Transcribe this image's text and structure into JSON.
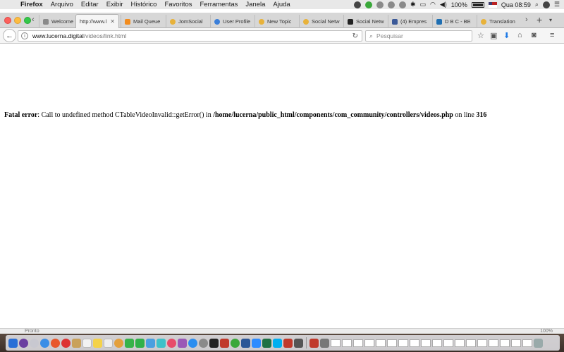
{
  "menubar": {
    "apple_icon": "apple-logo-icon",
    "items": [
      "Firefox",
      "Arquivo",
      "Editar",
      "Exibir",
      "Histórico",
      "Favoritos",
      "Ferramentas",
      "Janela",
      "Ajuda"
    ],
    "battery": "100%",
    "clock": "Qua 08:59"
  },
  "tabs": [
    {
      "label": "Welcome t",
      "icon": "joomla-icon",
      "active": false
    },
    {
      "label": "http://www.l",
      "icon": "",
      "active": true
    },
    {
      "label": "Mail Queue",
      "icon": "joomla-icon",
      "active": false
    },
    {
      "label": "JomSocial",
      "icon": "loading-icon",
      "active": false
    },
    {
      "label": "User Profile",
      "icon": "globe-icon",
      "active": false
    },
    {
      "label": "New Topic",
      "icon": "loading-icon",
      "active": false
    },
    {
      "label": "Social Netw",
      "icon": "loading-icon",
      "active": false
    },
    {
      "label": "Social Netw",
      "icon": "s-icon",
      "active": false
    },
    {
      "label": "(4) Empres",
      "icon": "facebook-icon",
      "active": false
    },
    {
      "label": "D B C - BE",
      "icon": "trello-icon",
      "active": false
    },
    {
      "label": "Translation",
      "icon": "loading-icon",
      "active": false
    }
  ],
  "navbar": {
    "url_host": "www.lucerna.digital",
    "url_path": "/videos/link.html",
    "search_placeholder": "Pesquisar"
  },
  "page": {
    "error_label": "Fatal error",
    "error_sep": ": ",
    "error_text": "Call to undefined method CTableVideoInvalid::getError() in ",
    "error_file": "/home/lucerna/public_html/components/com_community/controllers/videos.php",
    "error_line_label": " on line ",
    "error_line": "316"
  },
  "statusbar": {
    "left": "Pronto",
    "right": "100%"
  },
  "colors": {
    "menubar_bg": "#e8e8e8",
    "tabstrip_bg": "#d7d7d7",
    "toolbar_bg": "#f5f5f5",
    "download_accent": "#1e7ae6"
  }
}
